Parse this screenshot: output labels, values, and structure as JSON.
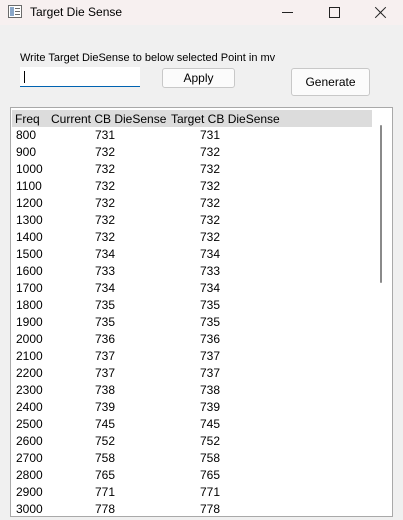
{
  "window": {
    "title": "Target Die Sense"
  },
  "form": {
    "instruction": "Write Target DieSense to below selected Point in mv",
    "input_value": "",
    "apply_label": "Apply",
    "generate_label": "Generate"
  },
  "table": {
    "headers": [
      "Freq",
      "Current CB DieSense",
      "Target CB DieSense"
    ],
    "rows": [
      [
        "800",
        "731",
        "731"
      ],
      [
        "900",
        "732",
        "732"
      ],
      [
        "1000",
        "732",
        "732"
      ],
      [
        "1100",
        "732",
        "732"
      ],
      [
        "1200",
        "732",
        "732"
      ],
      [
        "1300",
        "732",
        "732"
      ],
      [
        "1400",
        "732",
        "732"
      ],
      [
        "1500",
        "734",
        "734"
      ],
      [
        "1600",
        "733",
        "733"
      ],
      [
        "1700",
        "734",
        "734"
      ],
      [
        "1800",
        "735",
        "735"
      ],
      [
        "1900",
        "735",
        "735"
      ],
      [
        "2000",
        "736",
        "736"
      ],
      [
        "2100",
        "737",
        "737"
      ],
      [
        "2200",
        "737",
        "737"
      ],
      [
        "2300",
        "738",
        "738"
      ],
      [
        "2400",
        "739",
        "739"
      ],
      [
        "2500",
        "745",
        "745"
      ],
      [
        "2600",
        "752",
        "752"
      ],
      [
        "2700",
        "758",
        "758"
      ],
      [
        "2800",
        "765",
        "765"
      ],
      [
        "2900",
        "771",
        "771"
      ],
      [
        "3000",
        "778",
        "778"
      ]
    ]
  },
  "icons": {
    "app": "app-window-icon",
    "minimize": "minimize-icon",
    "maximize": "maximize-icon",
    "close": "close-icon"
  },
  "colors": {
    "title_bar": "#f7f0f0",
    "window_bg": "#f0f0f0",
    "header_bg": "#dcdcdc",
    "input_underline": "#0063b1"
  }
}
